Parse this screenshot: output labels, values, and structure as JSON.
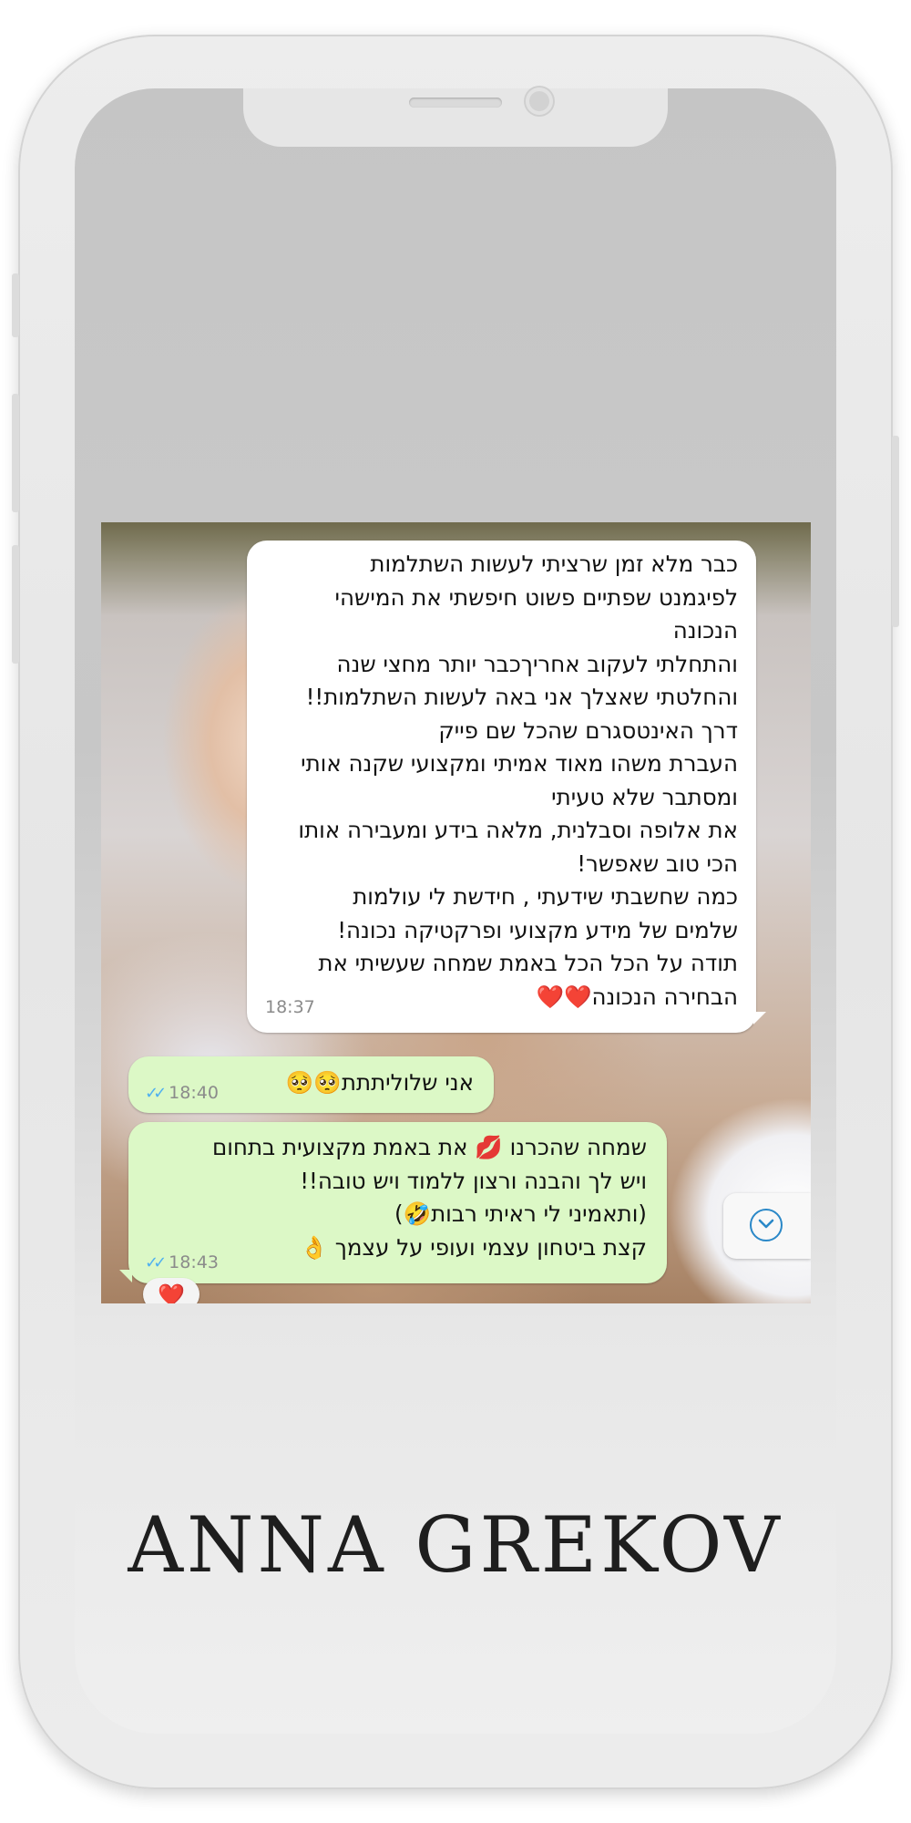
{
  "chat": {
    "incoming": {
      "lines": [
        "כבר מלא זמן שרציתי לעשות השתלמות",
        "לפיגמנט שפתיים פשוט חיפשתי את המישהי",
        "הנכונה",
        "והתחלתי לעקוב אחריךכבר יותר מחצי שנה",
        "והחלטתי שאצלך אני באה לעשות השתלמות!!",
        "דרך האינטסגרם שהכל שם פייק",
        "העברת משהו מאוד אמיתי ומקצועי שקנה אותי",
        "ומסתבר שלא טעיתי",
        "את אלופה וסבלנית, מלאה בידע ומעבירה אותו",
        "הכי טוב שאפשר!",
        "כמה שחשבתי שידעתי , חידשת לי עולמות",
        "שלמים של מידע מקצועי ופרקטיקה נכונה!",
        "תודה על הכל הכל באמת שמחה שעשיתי את",
        "הבחירה הנכונה❤️❤️"
      ],
      "time": "18:37"
    },
    "outgoing1": {
      "text": "אני שלוליתתת🥺🥺",
      "time": "18:40"
    },
    "outgoing2": {
      "lines": [
        "שמחה שהכרנו 💋 את באמת מקצועית בתחום",
        "ויש לך והבנה ורצון ללמוד ויש טובה!!",
        "(ותאמיני לי ראיתי רבות🤣)",
        "קצת ביטחון עצמי ועופי על עצמך 👌"
      ],
      "time": "18:43",
      "reaction": "❤️"
    },
    "read_ticks": "✓✓",
    "tick_color": "#4fb0f0",
    "outgoing_bubble_color": "#dcf8c6"
  },
  "brand": "ANNA GREKOV"
}
